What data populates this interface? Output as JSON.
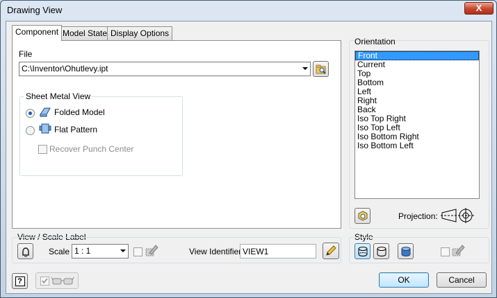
{
  "window": {
    "title": "Drawing View",
    "close_label": "X"
  },
  "tabs": [
    {
      "label": "Component"
    },
    {
      "label": "Model State"
    },
    {
      "label": "Display Options"
    }
  ],
  "file": {
    "label": "File",
    "value": "C:\\Inventor\\Ohutlevy.ipt"
  },
  "sheet_metal": {
    "legend": "Sheet Metal View",
    "folded_label": "Folded Model",
    "flat_label": "Flat Pattern",
    "recover_label": "Recover Punch Center"
  },
  "orientation": {
    "legend": "Orientation",
    "items": [
      "Front",
      "Current",
      "Top",
      "Bottom",
      "Left",
      "Right",
      "Back",
      "Iso Top Right",
      "Iso Top Left",
      "Iso Bottom Right",
      "Iso Bottom Left"
    ],
    "selected": "Front",
    "projection_label": "Projection:"
  },
  "view_scale": {
    "legend": "View / Scale Label",
    "scale_label": "Scale",
    "scale_value": "1 : 1",
    "identifier_label": "View Identifier",
    "identifier_value": "VIEW1"
  },
  "style": {
    "legend": "Style"
  },
  "buttons": {
    "ok": "OK",
    "cancel": "Cancel"
  },
  "help": {
    "icon_text": "?"
  }
}
